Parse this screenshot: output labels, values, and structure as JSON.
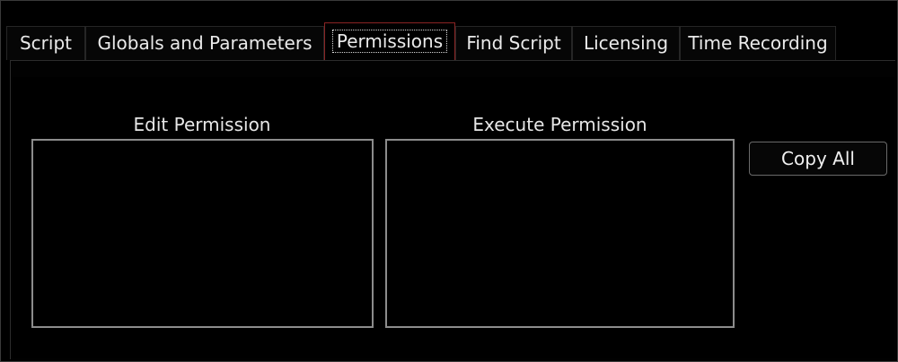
{
  "tabs": [
    {
      "label": "Script",
      "active": false
    },
    {
      "label": "Globals and Parameters",
      "active": false
    },
    {
      "label": "Permissions",
      "active": true
    },
    {
      "label": "Find Script",
      "active": false
    },
    {
      "label": "Licensing",
      "active": false
    },
    {
      "label": "Time Recording",
      "active": false
    }
  ],
  "permissions": {
    "edit_label": "Edit Permission",
    "execute_label": "Execute Permission",
    "copy_all_label": "Copy All"
  },
  "colors": {
    "background": "#000000",
    "active_tab_border": "#8a2424",
    "listbox_border": "#8c8c8c"
  }
}
